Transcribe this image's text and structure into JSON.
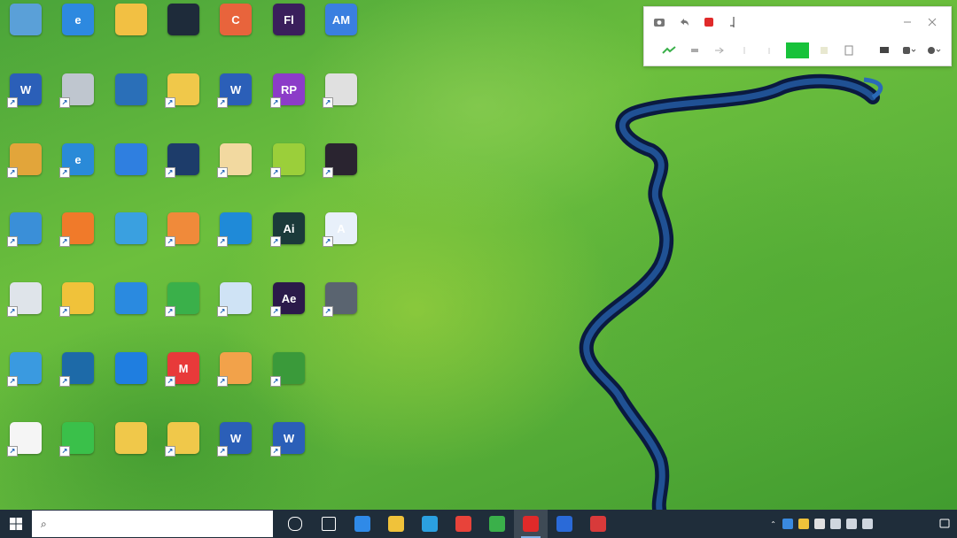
{
  "desktop": {
    "icons": [
      {
        "id": "r0c0",
        "label": "",
        "color": "#5aa0d8",
        "glyph": ""
      },
      {
        "id": "r0c1",
        "label": "",
        "color": "#2d89e0",
        "glyph": "e"
      },
      {
        "id": "r0c2",
        "label": "",
        "color": "#f2c043",
        "glyph": ""
      },
      {
        "id": "r0c3",
        "label": "",
        "color": "#1e2b3a",
        "glyph": ""
      },
      {
        "id": "r0c4",
        "label": "",
        "color": "#e8643c",
        "glyph": "C"
      },
      {
        "id": "r0c5",
        "label": "",
        "color": "#3a1f5c",
        "glyph": "Fl"
      },
      {
        "id": "r0c6",
        "label": "",
        "color": "#3a7fe0",
        "glyph": "AM"
      },
      {
        "id": "r1c0",
        "label": "",
        "color": "#2b5fb8",
        "glyph": "W"
      },
      {
        "id": "r1c1",
        "label": "",
        "color": "#bfc6cf",
        "glyph": ""
      },
      {
        "id": "r1c2",
        "label": "",
        "color": "#2a6fb8",
        "glyph": ""
      },
      {
        "id": "r1c3",
        "label": "",
        "color": "#f0c84a",
        "glyph": ""
      },
      {
        "id": "r1c4",
        "label": "",
        "color": "#2b5fb8",
        "glyph": "W"
      },
      {
        "id": "r1c5",
        "label": "",
        "color": "#8c3cc8",
        "glyph": "RP"
      },
      {
        "id": "r1c6",
        "label": "",
        "color": "#e0e0e0",
        "glyph": ""
      },
      {
        "id": "r2c0",
        "label": "",
        "color": "#e2a53a",
        "glyph": ""
      },
      {
        "id": "r2c1",
        "label": "",
        "color": "#2a8ad8",
        "glyph": "e"
      },
      {
        "id": "r2c2",
        "label": "",
        "color": "#2f7fe0",
        "glyph": ""
      },
      {
        "id": "r2c3",
        "label": "",
        "color": "#1d3c6a",
        "glyph": ""
      },
      {
        "id": "r2c4",
        "label": "",
        "color": "#f2d9a0",
        "glyph": ""
      },
      {
        "id": "r2c5",
        "label": "",
        "color": "#9bcf3a",
        "glyph": ""
      },
      {
        "id": "r2c6",
        "label": "",
        "color": "#2a2430",
        "glyph": ""
      },
      {
        "id": "r3c0",
        "label": "",
        "color": "#3a8fd8",
        "glyph": ""
      },
      {
        "id": "r3c1",
        "label": "",
        "color": "#f07a2a",
        "glyph": ""
      },
      {
        "id": "r3c2",
        "label": "",
        "color": "#3aa0e0",
        "glyph": ""
      },
      {
        "id": "r3c3",
        "label": "",
        "color": "#f08a3a",
        "glyph": ""
      },
      {
        "id": "r3c4",
        "label": "",
        "color": "#1f8ad8",
        "glyph": ""
      },
      {
        "id": "r3c5",
        "label": "",
        "color": "#1b3a3a",
        "glyph": "Ai"
      },
      {
        "id": "r3c6",
        "label": "",
        "color": "#e8f0fa",
        "glyph": "A"
      },
      {
        "id": "r4c0",
        "label": "",
        "color": "#dfe4ea",
        "glyph": ""
      },
      {
        "id": "r4c1",
        "label": "",
        "color": "#f0c23a",
        "glyph": ""
      },
      {
        "id": "r4c2",
        "label": "",
        "color": "#2a8ae0",
        "glyph": ""
      },
      {
        "id": "r4c3",
        "label": "",
        "color": "#3ab04a",
        "glyph": ""
      },
      {
        "id": "r4c4",
        "label": "",
        "color": "#cfe3f5",
        "glyph": ""
      },
      {
        "id": "r4c5",
        "label": "",
        "color": "#2b1a4a",
        "glyph": "Ae"
      },
      {
        "id": "r4c6",
        "label": "",
        "color": "#5a6470",
        "glyph": ""
      },
      {
        "id": "r5c0",
        "label": "",
        "color": "#3a9ae0",
        "glyph": ""
      },
      {
        "id": "r5c1",
        "label": "",
        "color": "#1d6aa8",
        "glyph": ""
      },
      {
        "id": "r5c2",
        "label": "",
        "color": "#1f7ee0",
        "glyph": ""
      },
      {
        "id": "r5c3",
        "label": "",
        "color": "#e83a3a",
        "glyph": "M"
      },
      {
        "id": "r5c4",
        "label": "",
        "color": "#f2a24a",
        "glyph": ""
      },
      {
        "id": "r5c5",
        "label": "",
        "color": "#3a9a3a",
        "glyph": ""
      },
      {
        "id": "r6c0",
        "label": "",
        "color": "#f5f5f5",
        "glyph": ""
      },
      {
        "id": "r6c1",
        "label": "",
        "color": "#3ac04a",
        "glyph": ""
      },
      {
        "id": "r6c2",
        "label": "",
        "color": "#f0c84a",
        "glyph": ""
      },
      {
        "id": "r6c3",
        "label": "",
        "color": "#f0c84a",
        "glyph": ""
      },
      {
        "id": "r6c4",
        "label": "",
        "color": "#2b5fb8",
        "glyph": "W"
      },
      {
        "id": "r6c5",
        "label": "",
        "color": "#2b5fb8",
        "glyph": "W"
      }
    ]
  },
  "recording_toolbar": {
    "title": "",
    "record_color": "#e02a2a",
    "green_color": "#17c23a"
  },
  "taskbar": {
    "search_placeholder": "",
    "apps": [
      {
        "name": "task-view",
        "color": "#ffffff"
      },
      {
        "name": "multitask",
        "color": "#ffffff"
      },
      {
        "name": "app-blue-bird",
        "color": "#2f8ae8"
      },
      {
        "name": "file-explorer",
        "color": "#f0c23a"
      },
      {
        "name": "edge",
        "color": "#2ba0e0"
      },
      {
        "name": "chrome",
        "color": "#e8433a"
      },
      {
        "name": "wechat",
        "color": "#3ab04a"
      },
      {
        "name": "recorder",
        "color": "#e02a2a"
      },
      {
        "name": "monitor",
        "color": "#2a6ad8"
      },
      {
        "name": "red-app",
        "color": "#d83a3a"
      }
    ],
    "tray_time": "",
    "tray_date": ""
  }
}
